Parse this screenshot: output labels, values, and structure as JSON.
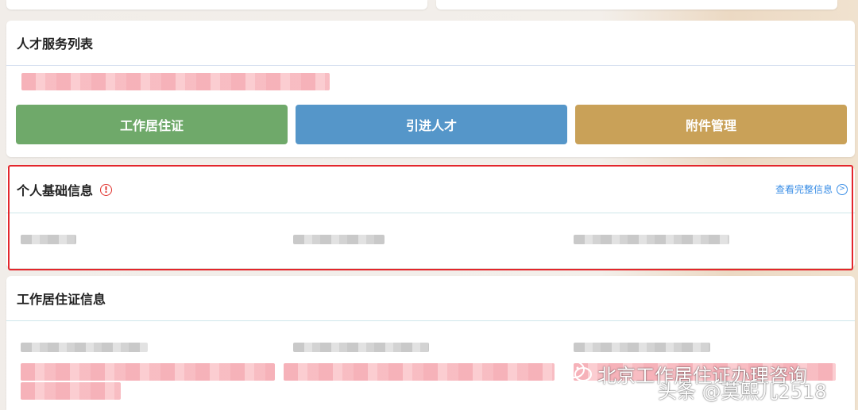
{
  "service_list": {
    "title": "人才服务列表",
    "buttons": [
      {
        "label": "工作居住证",
        "color": "#6fa96a"
      },
      {
        "label": "引进人才",
        "color": "#5596c9"
      },
      {
        "label": "附件管理",
        "color": "#c9a158"
      }
    ]
  },
  "personal_info": {
    "title": "个人基础信息",
    "alert_icon": "!",
    "more_link": "查看完整信息",
    "highlight_color": "#e3262c"
  },
  "permit_info": {
    "title": "工作居住证信息"
  },
  "watermarks": {
    "account_name": "北京工作居住证办理咨询",
    "platform_tag": "头条 @莫熙儿2518"
  }
}
